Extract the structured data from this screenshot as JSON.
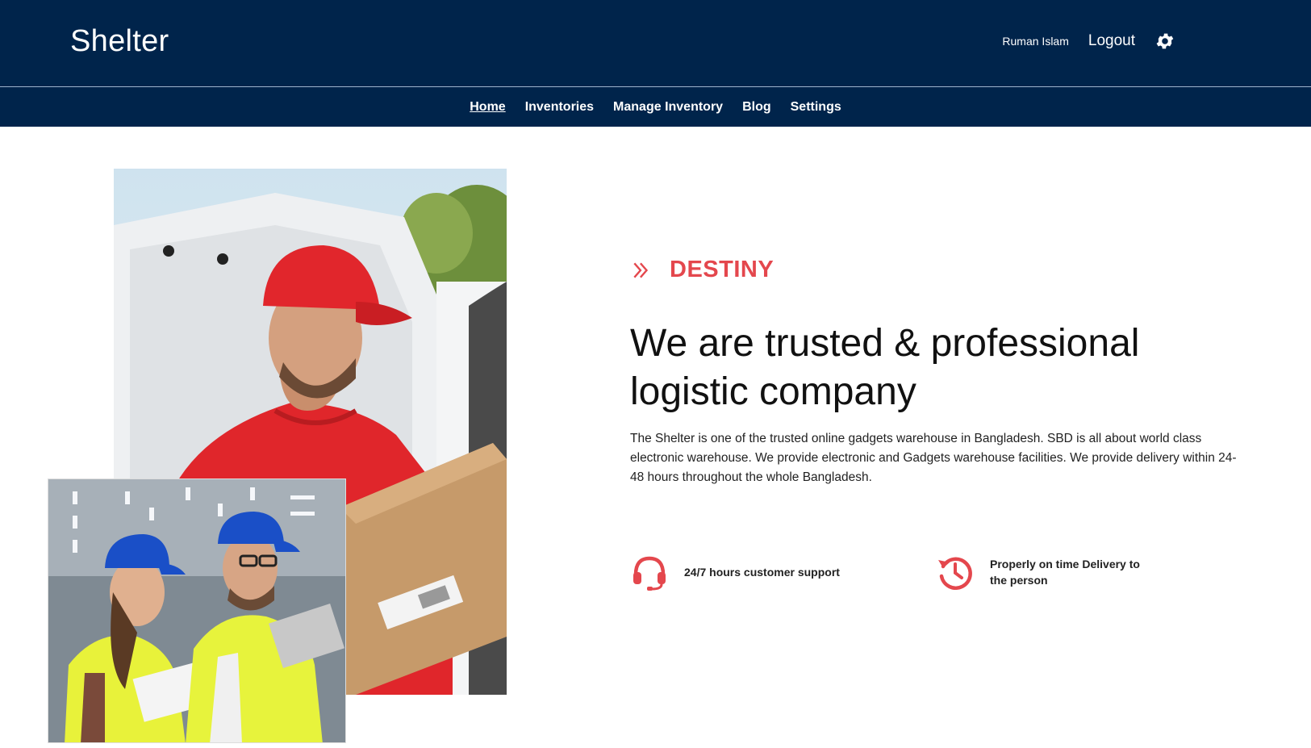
{
  "header": {
    "brand": "Shelter",
    "user_name": "Ruman Islam",
    "logout_label": "Logout",
    "settings_icon": "gear-icon",
    "bg_color": "#00244b"
  },
  "nav": {
    "items": [
      {
        "label": "Home",
        "active": true
      },
      {
        "label": "Inventories"
      },
      {
        "label": "Manage Inventory"
      },
      {
        "label": "Blog"
      },
      {
        "label": "Settings"
      }
    ]
  },
  "hero": {
    "kicker_icon": "double-chevron-right-icon",
    "kicker": "DESTINY",
    "headline": "We are trusted & professional logistic company",
    "description": "The Shelter is one of the trusted online gadgets warehouse in Bangladesh. SBD is all about world class electronic warehouse. We provide electronic and Gadgets warehouse facilities. We provide delivery within 24-48 hours throughout the whole Bangladesh.",
    "accent_color": "#e4474d",
    "features": [
      {
        "icon": "headset-icon",
        "text": "24/7 hours customer support"
      },
      {
        "icon": "clock-history-icon",
        "text": "Properly on time Delivery to the person"
      }
    ]
  }
}
